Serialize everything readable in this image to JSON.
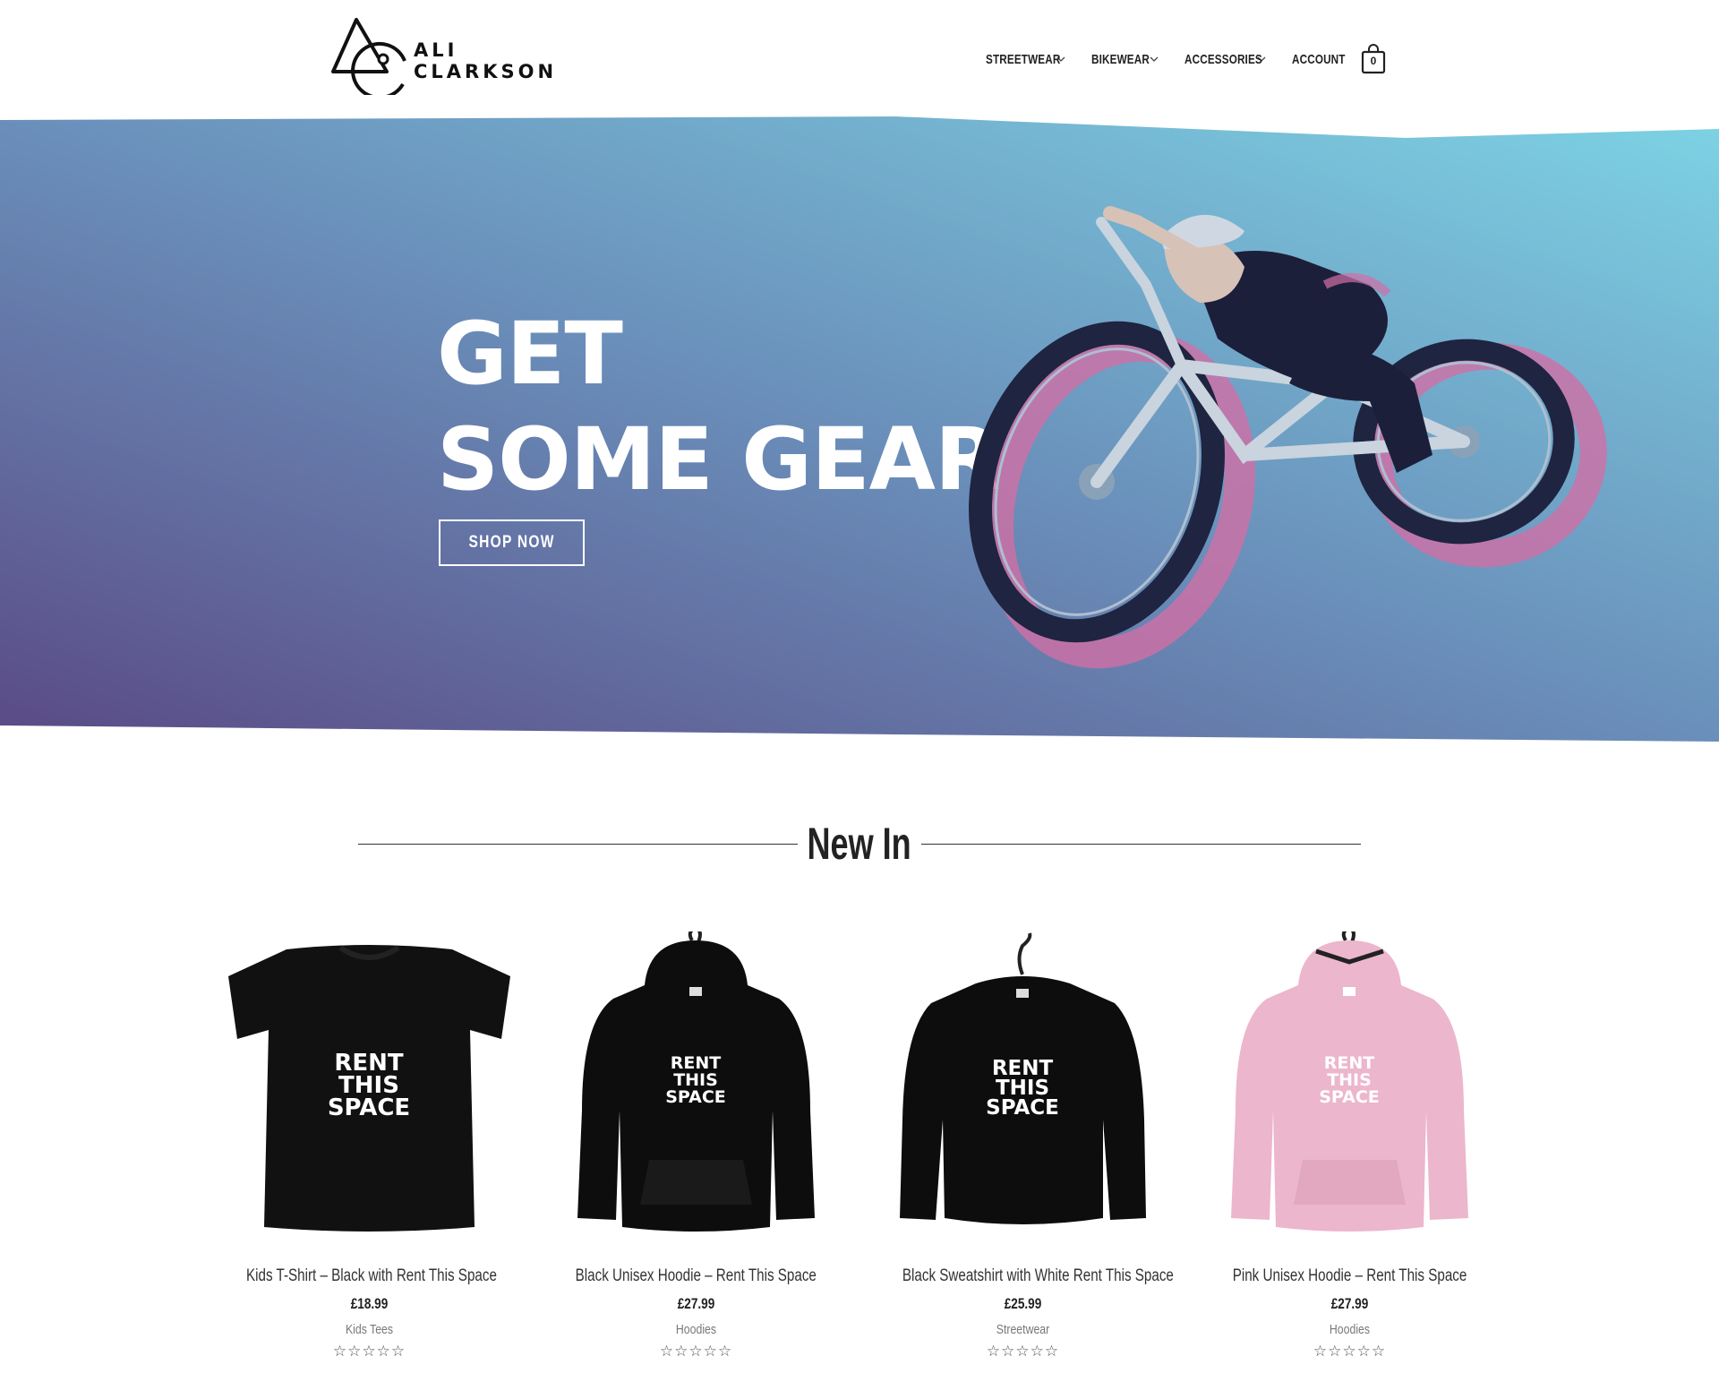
{
  "brand": {
    "line1": "ALI",
    "line2": "CLARKSON"
  },
  "nav": {
    "items": [
      {
        "label": "STREETWEAR",
        "has_dropdown": true
      },
      {
        "label": "BIKEWEAR",
        "has_dropdown": true
      },
      {
        "label": "ACCESSORIES",
        "has_dropdown": true
      },
      {
        "label": "ACCOUNT",
        "has_dropdown": false
      }
    ],
    "cart_count": "0"
  },
  "hero": {
    "title_line1": "GET",
    "title_line2": "SOME GEAR",
    "button": "SHOP NOW",
    "gradient": [
      "#5a4a85",
      "#6a8fba",
      "#7dd3e4"
    ]
  },
  "new_in": {
    "title": "New In",
    "products": [
      {
        "name": "Kids T-Shirt – Black with Rent This Space",
        "price": "£18.99",
        "category": "Kids Tees",
        "rating": "☆☆☆☆☆",
        "print": [
          "RENT",
          "THIS",
          "SPACE"
        ],
        "color": "#111111",
        "type": "tshirt"
      },
      {
        "name": "Black Unisex Hoodie – Rent This Space",
        "price": "£27.99",
        "category": "Hoodies",
        "rating": "☆☆☆☆☆",
        "print": [
          "RENT",
          "THIS",
          "SPACE"
        ],
        "color": "#0d0d0d",
        "type": "hoodie"
      },
      {
        "name": "Black Sweatshirt with White Rent This Space",
        "price": "£25.99",
        "category": "Streetwear",
        "rating": "☆☆☆☆☆",
        "print": [
          "RENT",
          "THIS",
          "SPACE"
        ],
        "color": "#0d0d0d",
        "type": "sweatshirt"
      },
      {
        "name": "Pink Unisex Hoodie – Rent This Space",
        "price": "£27.99",
        "category": "Hoodies",
        "rating": "☆☆☆☆☆",
        "print": [
          "RENT",
          "THIS",
          "SPACE"
        ],
        "color": "#ecb6cc",
        "type": "hoodie"
      }
    ]
  }
}
